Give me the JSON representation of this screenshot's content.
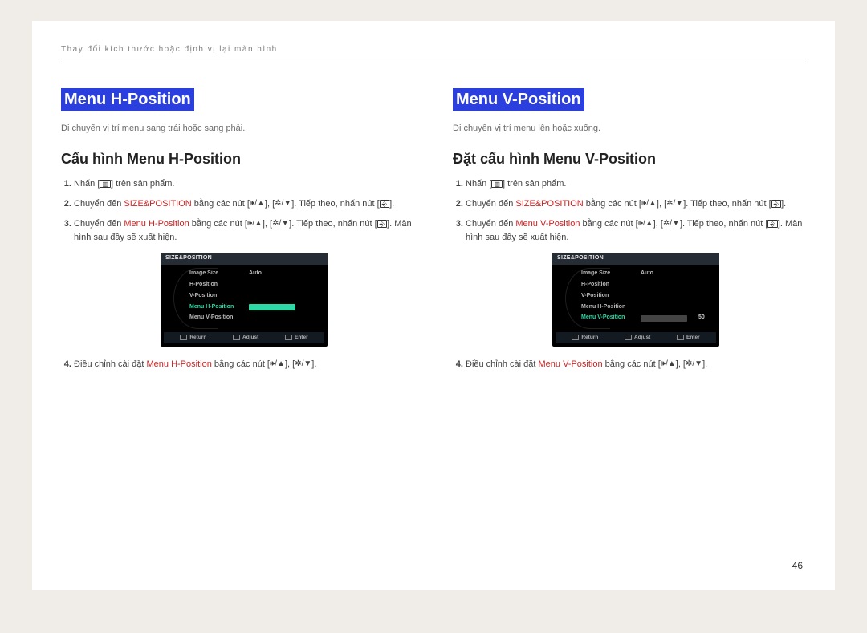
{
  "breadcrumb": "Thay đổi kích thước hoặc định vị lại màn hình",
  "page_num": "46",
  "left": {
    "title": "Menu H-Position",
    "lead": "Di chuyển vị trí menu sang trái hoặc sang phải.",
    "subhead": "Cấu hình Menu H-Position",
    "steps": {
      "s1_a": "Nhấn [",
      "s1_b": "] trên sản phẩm.",
      "s2_a": "Chuyển đến ",
      "s2_red": "SIZE&POSITION",
      "s2_b": " bằng các nút [",
      "s2_c": "], [",
      "s2_d": "]. Tiếp theo, nhấn nút [",
      "s2_e": "].",
      "s3_a": "Chuyển đến ",
      "s3_red": "Menu H-Position",
      "s3_b": " bằng các nút [",
      "s3_c": "], [",
      "s3_d": "]. Tiếp theo, nhấn nút [",
      "s3_e": "]. Màn hình sau đây sẽ xuất hiện.",
      "s4_a": "Điều chỉnh cài đặt ",
      "s4_red": "Menu H-Position",
      "s4_b": " bằng các nút [",
      "s4_c": "], [",
      "s4_d": "]."
    },
    "osd": {
      "title": "SIZE&POSITION",
      "r1": "Image Size",
      "r1v": "Auto",
      "r2": "H-Position",
      "r3": "V-Position",
      "r4": "Menu H-Position",
      "r5": "Menu V-Position",
      "foot_return": "Return",
      "foot_adjust": "Adjust",
      "foot_enter": "Enter"
    }
  },
  "right": {
    "title": "Menu V-Position",
    "lead": "Di chuyển vị trí menu lên hoặc xuống.",
    "subhead": "Đặt cấu hình Menu V-Position",
    "steps": {
      "s1_a": "Nhấn [",
      "s1_b": "] trên sản phẩm.",
      "s2_a": "Chuyển đến ",
      "s2_red": "SIZE&POSITION",
      "s2_b": " bằng các nút [",
      "s2_c": "], [",
      "s2_d": "]. Tiếp theo, nhấn nút [",
      "s2_e": "].",
      "s3_a": "Chuyển đến ",
      "s3_red": "Menu V-Position",
      "s3_b": " bằng các nút [",
      "s3_c": "], [",
      "s3_d": "]. Tiếp theo, nhấn nút [",
      "s3_e": "].  Màn hình sau đây sẽ xuất hiện.",
      "s4_a": "Điều chỉnh cài đặt ",
      "s4_red": "Menu V-Position",
      "s4_b": " bằng các nút [",
      "s4_c": "], [",
      "s4_d": "]."
    },
    "osd": {
      "title": "SIZE&POSITION",
      "r1": "Image Size",
      "r1v": "Auto",
      "r2": "H-Position",
      "r3": "V-Position",
      "r4": "Menu H-Position",
      "r5": "Menu V-Position",
      "r5v": "50",
      "foot_return": "Return",
      "foot_adjust": "Adjust",
      "foot_enter": "Enter"
    }
  },
  "glyphs": {
    "menu": "▥",
    "vol_up": "🕪/▲",
    "vol_dn": "✲/▼",
    "enter": "⎆"
  }
}
